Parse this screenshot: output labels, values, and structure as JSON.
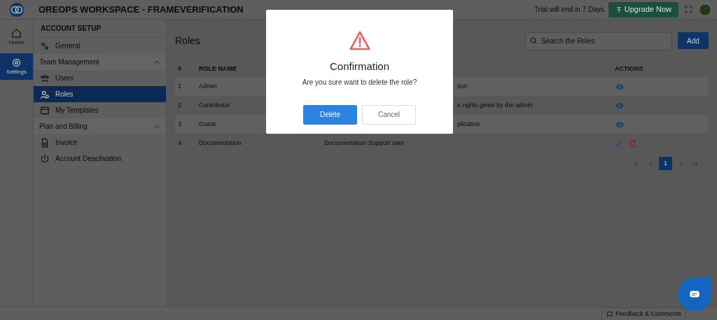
{
  "topbar": {
    "title": "OREOPS WORKSPACE - FRAMEVERIFICATION",
    "trial": "Trial will end in 7 Days",
    "upgrade": "Upgrade Now"
  },
  "rail": [
    {
      "label": "Home",
      "selected": false
    },
    {
      "label": "Settings",
      "selected": true
    }
  ],
  "sidebar": {
    "heading": "ACCOUNT SETUP",
    "items": [
      {
        "kind": "item",
        "label": "General",
        "selected": false
      },
      {
        "kind": "group",
        "label": "Team Management",
        "expanded": true
      },
      {
        "kind": "item",
        "label": "Users",
        "selected": false
      },
      {
        "kind": "item",
        "label": "Roles",
        "selected": true
      },
      {
        "kind": "item",
        "label": "My Templates",
        "selected": false
      },
      {
        "kind": "group",
        "label": "Plan and Billing",
        "expanded": true
      },
      {
        "kind": "item",
        "label": "Invoice",
        "selected": false
      },
      {
        "kind": "item",
        "label": "Account Deactivation",
        "selected": false
      }
    ]
  },
  "page": {
    "title": "Roles",
    "search": {
      "placeholder": "Search the Roles"
    },
    "add": "Add"
  },
  "table": {
    "columns": [
      "#",
      "ROLE NAME",
      "ACTIONS"
    ],
    "rows": [
      {
        "index": "1",
        "name": "Admin",
        "description": "tion",
        "cut": true,
        "kind": "builtin"
      },
      {
        "index": "2",
        "name": "Contributor",
        "description": "e rights given by the admin",
        "cut": true,
        "kind": "builtin"
      },
      {
        "index": "3",
        "name": "Guest",
        "description": "plication",
        "cut": true,
        "kind": "builtin"
      },
      {
        "index": "4",
        "name": "Documentation",
        "description": "Documentation Support user",
        "kind": "custom"
      }
    ]
  },
  "pagination": {
    "pages": [
      {
        "label": "1",
        "selected": true
      }
    ]
  },
  "feedback": "Feedback & Comments",
  "dialog": {
    "title": "Confirmation",
    "message": "Are you sure want to delete the role?",
    "confirm": "Delete",
    "cancel": "Cancel"
  }
}
